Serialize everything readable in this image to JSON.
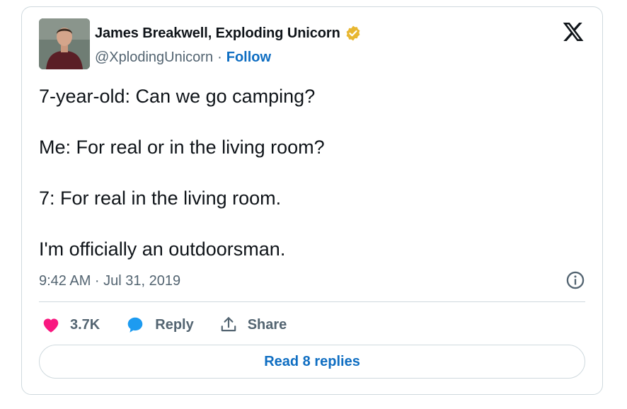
{
  "author": {
    "name": "James Breakwell, Exploding Unicorn",
    "handle": "@XplodingUnicorn",
    "separator": "·",
    "follow_label": "Follow",
    "verified_badge_color": "#e8b731"
  },
  "tweet": {
    "lines": [
      "7-year-old: Can we go camping?",
      "Me: For real or in the living room?",
      "7: For real in the living room.",
      "I'm officially an outdoorsman."
    ],
    "timestamp": "9:42 AM · Jul 31, 2019"
  },
  "actions": {
    "like_count": "3.7K",
    "reply_label": "Reply",
    "share_label": "Share"
  },
  "read_replies_label": "Read 8 replies",
  "icons": {
    "brand": "x-logo-icon",
    "like": "heart-icon",
    "reply": "speech-bubble-icon",
    "share": "share-upload-icon",
    "info": "info-icon",
    "verified": "verified-badge-icon"
  },
  "colors": {
    "like": "#f91880",
    "reply": "#1d9bf0",
    "link": "#0f6ec2",
    "muted": "#536471",
    "border": "#cfd9de"
  }
}
